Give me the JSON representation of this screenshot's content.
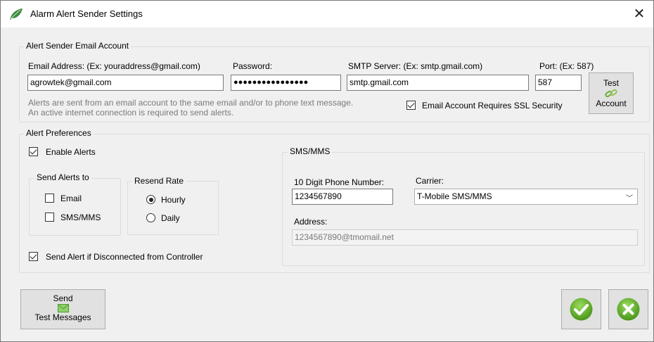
{
  "window": {
    "title": "Alarm Alert Sender Settings"
  },
  "email_account": {
    "group_label": "Alert Sender Email Account",
    "email_label": "Email Address:  (Ex: youraddress@gmail.com)",
    "email_value": "agrowtek@gmail.com",
    "password_label": "Password:",
    "password_value": "●●●●●●●●●●●●●●●●",
    "smtp_label": "SMTP Server: (Ex: smtp.gmail.com)",
    "smtp_value": "smtp.gmail.com",
    "port_label": "Port: (Ex: 587)",
    "port_value": "587",
    "info_line1": "Alerts are sent from an email account to the same email and/or to phone text message.",
    "info_line2": "An active internet connection is required to send alerts.",
    "ssl_label": "Email Account Requires SSL Security",
    "ssl_checked": true,
    "test_button_line1": "Test",
    "test_button_line2": "Account"
  },
  "preferences": {
    "group_label": "Alert Preferences",
    "enable_alerts_label": "Enable Alerts",
    "enable_alerts_checked": true,
    "send_to": {
      "label": "Send Alerts to",
      "email_label": "Email",
      "email_checked": false,
      "sms_label": "SMS/MMS",
      "sms_checked": false
    },
    "resend": {
      "label": "Resend Rate",
      "hourly_label": "Hourly",
      "daily_label": "Daily",
      "selected": "Hourly"
    },
    "disconnected_label": "Send Alert if Disconnected from Controller",
    "disconnected_checked": true,
    "sms": {
      "group_label": "SMS/MMS",
      "phone_label": "10 Digit Phone Number:",
      "phone_value": "1234567890",
      "carrier_label": "Carrier:",
      "carrier_value": "T-Mobile SMS/MMS",
      "address_label": "Address:",
      "address_value": "1234567890@tmomail.net"
    }
  },
  "footer": {
    "send_button_line1": "Send",
    "send_button_line2": "Test Messages",
    "ok_icon": "checkmark-icon",
    "cancel_icon": "x-icon"
  },
  "colors": {
    "accept_green": "#5aa321",
    "app_leaf_green": "#3c8a3c"
  }
}
